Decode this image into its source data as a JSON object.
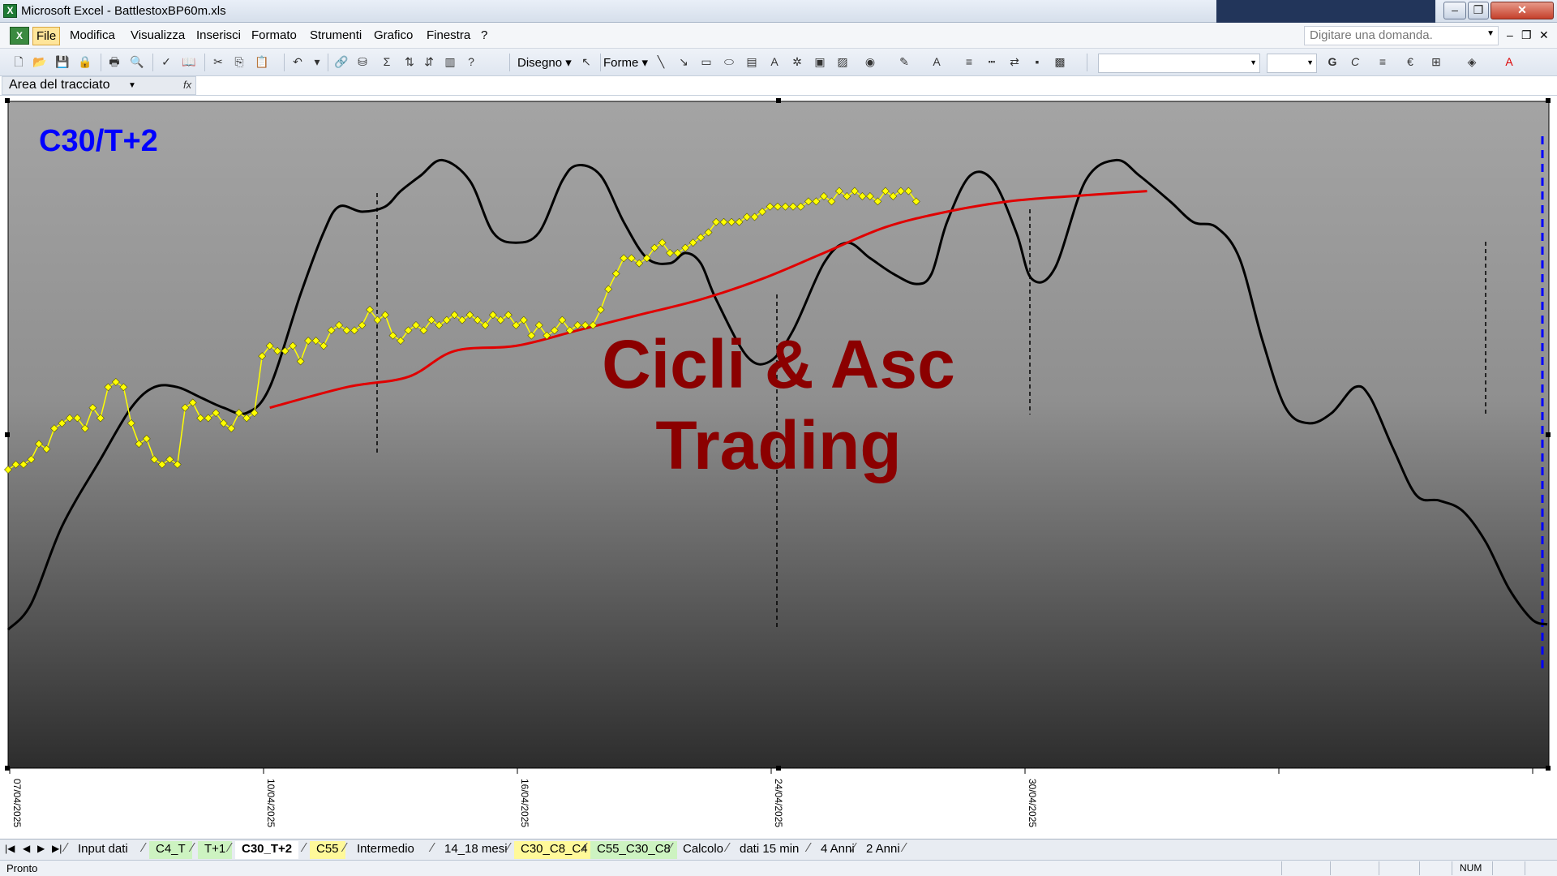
{
  "window": {
    "title": "Microsoft Excel - BattlestoxBP60m.xls",
    "controls": {
      "minimize": "–",
      "maximize": "❐",
      "close": "✕"
    }
  },
  "menu": {
    "items": [
      "File",
      "Modifica",
      "Visualizza",
      "Inserisci",
      "Formato",
      "Strumenti",
      "Grafico",
      "Finestra",
      "?"
    ],
    "active_index": 0,
    "help_placeholder": "Digitare una domanda."
  },
  "toolbar": {
    "draw_label": "Disegno",
    "shapes_label": "Forme",
    "bold": "G",
    "italic": "C",
    "euro": "€"
  },
  "formula_bar": {
    "name_box": "Area del tracciato",
    "fx": "fx"
  },
  "chart_data": {
    "type": "line",
    "chart_label": "C30/T+2",
    "watermark_line1": "Cicli & Asc",
    "watermark_line2": "Trading",
    "x_axis_labels": [
      "07/04/2025",
      "10/04/2025",
      "16/04/2025",
      "24/04/2025",
      "30/04/2025"
    ],
    "y_range": [
      0,
      100
    ],
    "x_range": [
      0,
      1000
    ],
    "colors": {
      "cycle": "#000000",
      "price": "#ffff00",
      "trend": "#e00000",
      "chart_label": "#0000ff",
      "watermark": "#8b0000"
    },
    "series": [
      {
        "id": "cycle",
        "points": [
          [
            0,
            5
          ],
          [
            15,
            10
          ],
          [
            35,
            25
          ],
          [
            60,
            38
          ],
          [
            80,
            48
          ],
          [
            95,
            52
          ],
          [
            110,
            52
          ],
          [
            125,
            50
          ],
          [
            140,
            48
          ],
          [
            155,
            47
          ],
          [
            170,
            52
          ],
          [
            190,
            70
          ],
          [
            205,
            82
          ],
          [
            215,
            87
          ],
          [
            230,
            86
          ],
          [
            245,
            87
          ],
          [
            255,
            90
          ],
          [
            268,
            93
          ],
          [
            282,
            96
          ],
          [
            300,
            92
          ],
          [
            315,
            82
          ],
          [
            330,
            80
          ],
          [
            345,
            82
          ],
          [
            360,
            92
          ],
          [
            370,
            95
          ],
          [
            385,
            93
          ],
          [
            400,
            84
          ],
          [
            415,
            77
          ],
          [
            430,
            76
          ],
          [
            440,
            78
          ],
          [
            450,
            76
          ],
          [
            460,
            69
          ],
          [
            480,
            58
          ],
          [
            495,
            57
          ],
          [
            510,
            63
          ],
          [
            530,
            76
          ],
          [
            545,
            80
          ],
          [
            560,
            77
          ],
          [
            575,
            74
          ],
          [
            590,
            72
          ],
          [
            600,
            74
          ],
          [
            610,
            84
          ],
          [
            625,
            93
          ],
          [
            640,
            92
          ],
          [
            655,
            82
          ],
          [
            665,
            73
          ],
          [
            680,
            75
          ],
          [
            700,
            92
          ],
          [
            720,
            96
          ],
          [
            735,
            93
          ],
          [
            755,
            88
          ],
          [
            770,
            84
          ],
          [
            785,
            83
          ],
          [
            800,
            77
          ],
          [
            815,
            61
          ],
          [
            830,
            48
          ],
          [
            845,
            45
          ],
          [
            860,
            47
          ],
          [
            875,
            52
          ],
          [
            885,
            50
          ],
          [
            900,
            40
          ],
          [
            915,
            31
          ],
          [
            930,
            30
          ],
          [
            945,
            28
          ],
          [
            960,
            22
          ],
          [
            975,
            13
          ],
          [
            990,
            7
          ],
          [
            1000,
            6
          ]
        ]
      },
      {
        "id": "price",
        "points": [
          [
            0,
            36
          ],
          [
            5,
            37
          ],
          [
            10,
            37
          ],
          [
            15,
            38
          ],
          [
            20,
            41
          ],
          [
            25,
            40
          ],
          [
            30,
            44
          ],
          [
            35,
            45
          ],
          [
            40,
            46
          ],
          [
            45,
            46
          ],
          [
            50,
            44
          ],
          [
            55,
            48
          ],
          [
            60,
            46
          ],
          [
            65,
            52
          ],
          [
            70,
            53
          ],
          [
            75,
            52
          ],
          [
            80,
            45
          ],
          [
            85,
            41
          ],
          [
            90,
            42
          ],
          [
            95,
            38
          ],
          [
            100,
            37
          ],
          [
            105,
            38
          ],
          [
            110,
            37
          ],
          [
            115,
            48
          ],
          [
            120,
            49
          ],
          [
            125,
            46
          ],
          [
            130,
            46
          ],
          [
            135,
            47
          ],
          [
            140,
            45
          ],
          [
            145,
            44
          ],
          [
            150,
            47
          ],
          [
            155,
            46
          ],
          [
            160,
            47
          ],
          [
            165,
            58
          ],
          [
            170,
            60
          ],
          [
            175,
            59
          ],
          [
            180,
            59
          ],
          [
            185,
            60
          ],
          [
            190,
            57
          ],
          [
            195,
            61
          ],
          [
            200,
            61
          ],
          [
            205,
            60
          ],
          [
            210,
            63
          ],
          [
            215,
            64
          ],
          [
            220,
            63
          ],
          [
            225,
            63
          ],
          [
            230,
            64
          ],
          [
            235,
            67
          ],
          [
            240,
            65
          ],
          [
            245,
            66
          ],
          [
            250,
            62
          ],
          [
            255,
            61
          ],
          [
            260,
            63
          ],
          [
            265,
            64
          ],
          [
            270,
            63
          ],
          [
            275,
            65
          ],
          [
            280,
            64
          ],
          [
            285,
            65
          ],
          [
            290,
            66
          ],
          [
            295,
            65
          ],
          [
            300,
            66
          ],
          [
            305,
            65
          ],
          [
            310,
            64
          ],
          [
            315,
            66
          ],
          [
            320,
            65
          ],
          [
            325,
            66
          ],
          [
            330,
            64
          ],
          [
            335,
            65
          ],
          [
            340,
            62
          ],
          [
            345,
            64
          ],
          [
            350,
            62
          ],
          [
            355,
            63
          ],
          [
            360,
            65
          ],
          [
            365,
            63
          ],
          [
            370,
            64
          ],
          [
            375,
            64
          ],
          [
            380,
            64
          ],
          [
            385,
            67
          ],
          [
            390,
            71
          ],
          [
            395,
            74
          ],
          [
            400,
            77
          ],
          [
            405,
            77
          ],
          [
            410,
            76
          ],
          [
            415,
            77
          ],
          [
            420,
            79
          ],
          [
            425,
            80
          ],
          [
            430,
            78
          ],
          [
            435,
            78
          ],
          [
            440,
            79
          ],
          [
            445,
            80
          ],
          [
            450,
            81
          ],
          [
            455,
            82
          ],
          [
            460,
            84
          ],
          [
            465,
            84
          ],
          [
            470,
            84
          ],
          [
            475,
            84
          ],
          [
            480,
            85
          ],
          [
            485,
            85
          ],
          [
            490,
            86
          ],
          [
            495,
            87
          ],
          [
            500,
            87
          ],
          [
            505,
            87
          ],
          [
            510,
            87
          ],
          [
            515,
            87
          ],
          [
            520,
            88
          ],
          [
            525,
            88
          ],
          [
            530,
            89
          ],
          [
            535,
            88
          ],
          [
            540,
            90
          ],
          [
            545,
            89
          ],
          [
            550,
            90
          ],
          [
            555,
            89
          ],
          [
            560,
            89
          ],
          [
            565,
            88
          ],
          [
            570,
            90
          ],
          [
            575,
            89
          ],
          [
            580,
            90
          ],
          [
            585,
            90
          ],
          [
            590,
            88
          ]
        ]
      },
      {
        "id": "trend",
        "points": [
          [
            0,
            48
          ],
          [
            50,
            52
          ],
          [
            90,
            54
          ],
          [
            120,
            59
          ],
          [
            160,
            60
          ],
          [
            200,
            63
          ],
          [
            240,
            66
          ],
          [
            280,
            69
          ],
          [
            320,
            73
          ],
          [
            360,
            78
          ],
          [
            400,
            83
          ],
          [
            440,
            86
          ],
          [
            480,
            88
          ],
          [
            520,
            89
          ],
          [
            570,
            90
          ]
        ]
      }
    ]
  },
  "sheet_tabs": [
    {
      "label": "Input dati",
      "style": "plain"
    },
    {
      "label": "C4_T",
      "style": "green"
    },
    {
      "label": "T+1",
      "style": "green"
    },
    {
      "label": "C30_T+2",
      "style": "active"
    },
    {
      "label": "C55",
      "style": "yellow"
    },
    {
      "label": "Intermedio",
      "style": "plain"
    },
    {
      "label": "14_18 mesi",
      "style": "plain"
    },
    {
      "label": "C30_C8_C4",
      "style": "yellow"
    },
    {
      "label": "C55_C30_C8",
      "style": "green"
    },
    {
      "label": "Calcolo",
      "style": "plain"
    },
    {
      "label": "dati 15 min",
      "style": "plain"
    },
    {
      "label": "4 Anni",
      "style": "plain"
    },
    {
      "label": "2 Anni",
      "style": "plain"
    }
  ],
  "status": {
    "left": "Pronto",
    "num": "NUM"
  }
}
